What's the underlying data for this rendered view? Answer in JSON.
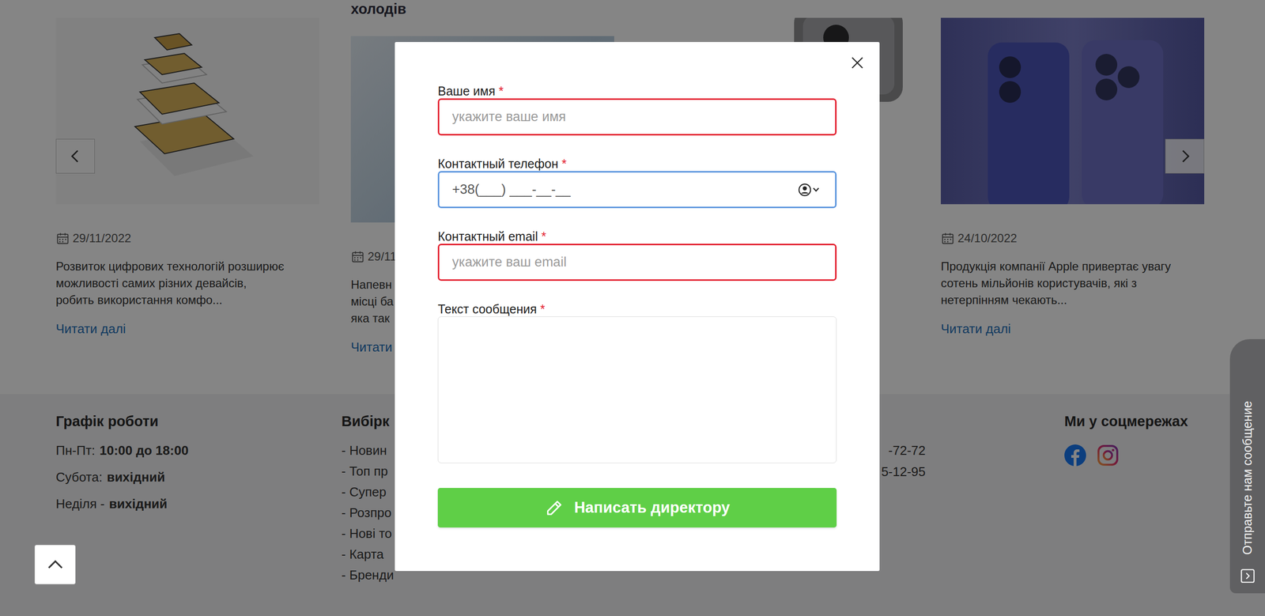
{
  "blog": {
    "cards": [
      {
        "kind": "sim",
        "title": "",
        "date": "29/11/2022",
        "lines": [
          "Розвиток цифрових технологій розширює",
          "можливості самих різних девайсів,",
          "робить використання комфо..."
        ],
        "link": "Читати далі"
      },
      {
        "kind": "frost",
        "title": "холодів",
        "date": "29/11",
        "lines": [
          "Напевн",
          "місці ба",
          "яка так"
        ],
        "link": "Читати"
      },
      {
        "kind": "phone",
        "title": "",
        "date": "",
        "lines": [],
        "link": ""
      },
      {
        "kind": "iphones",
        "title": "",
        "date": "24/10/2022",
        "lines": [
          "Продукція компанії Apple привертає увагу",
          "сотень мільйонів користувачів, які з",
          "нетерпінням чекають..."
        ],
        "link": "Читати далі"
      }
    ]
  },
  "footer": {
    "schedule": {
      "title": "Графік роботи",
      "rows": [
        {
          "label": "Пн-Пт:",
          "value": "10:00 до 18:00"
        },
        {
          "label": "Субота:",
          "value": "вихідний"
        },
        {
          "label": "Неділя -",
          "value": "вихідний"
        }
      ]
    },
    "links": {
      "title": "Вибірк",
      "items": [
        "- Новин",
        "- Топ пр",
        "- Супер",
        "- Розпро",
        "- Нові то",
        "- Карта",
        "- Бренди"
      ]
    },
    "phones": [
      "-72-72",
      "5-12-95"
    ],
    "social": {
      "title": "Ми у соцмережах",
      "networks": [
        {
          "kind": "facebook"
        },
        {
          "kind": "instagram"
        }
      ]
    }
  },
  "feedback_tab": {
    "label": "Отправьте нам сообщение"
  },
  "modal": {
    "required_mark": "*",
    "fields": [
      {
        "kind": "input",
        "label": "Ваше имя",
        "required": true,
        "placeholder": "укажите ваше имя",
        "value": "",
        "invalid": true,
        "focused": false
      },
      {
        "kind": "phone",
        "label": "Контактный телефон",
        "required": true,
        "placeholder": "",
        "value": "+38(___) ___-__-__",
        "invalid": false,
        "focused": true
      },
      {
        "kind": "input",
        "label": "Контактный email",
        "required": true,
        "placeholder": "укажите ваш email",
        "value": "",
        "invalid": true,
        "focused": false
      },
      {
        "kind": "textarea",
        "label": "Текст сообщения",
        "required": true,
        "placeholder": "",
        "value": "",
        "invalid": false,
        "focused": false
      }
    ],
    "submit": "Написать директору"
  }
}
